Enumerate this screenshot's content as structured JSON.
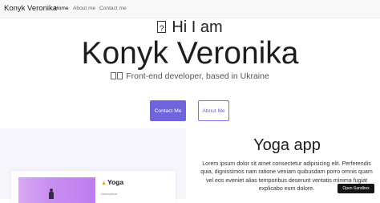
{
  "navbar": {
    "brand": "Konyk Veronika",
    "links": [
      "Home",
      "About me",
      "Contact me"
    ]
  },
  "hero": {
    "greeting": "Hi I am",
    "name": "Konyk Veronika",
    "subtitle": "Front-end developer, based in Ukraine",
    "primary_button": "Contact Me",
    "secondary_button": "About Me"
  },
  "project": {
    "card_title": "Yoga",
    "card_label": "Description",
    "title": "Yoga app",
    "description": "Lorem ipsum dolor sit amet consectetur adipisicing elit. Perferendis quia, dignissimos nam ratione veniam quibusdam porro omnis quam vel eos eveniet alias temporibus deserunt veritatis minima fugiat explicabo eum dolore."
  },
  "sandbox": {
    "label": "Open Sandbox"
  },
  "colors": {
    "accent": "#6e64dc",
    "navbar_bg": "#f8f8f9",
    "panel_bg": "#f6f5fb"
  },
  "icons": {
    "greeting_glyph": "missing-glyph-icon",
    "subtitle_glyphs": "missing-glyph-icon",
    "card_title_icon": "yoga-pose-icon"
  }
}
